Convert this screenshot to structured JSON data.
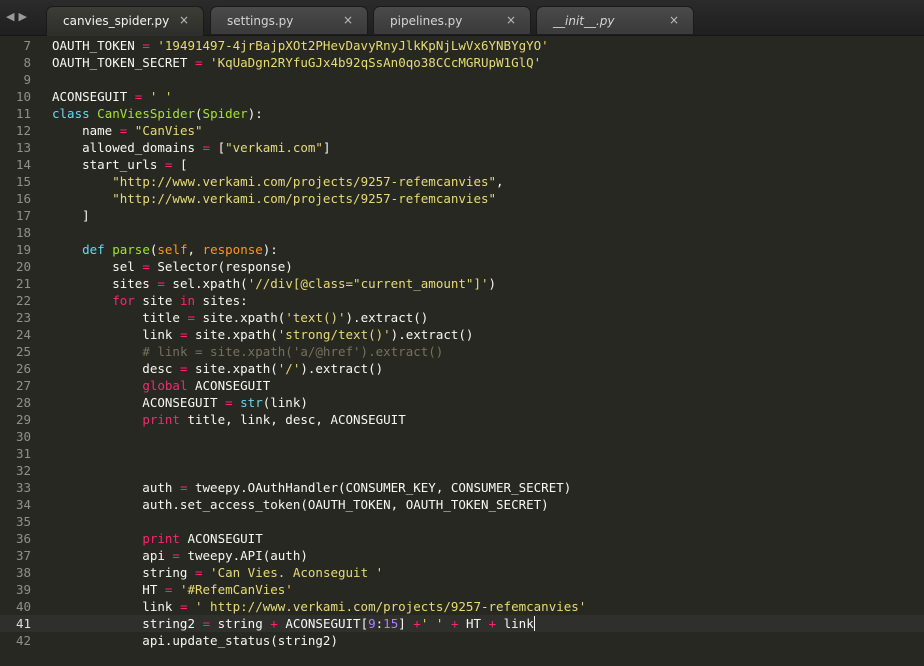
{
  "nav": {
    "back": "◀",
    "forward": "▶"
  },
  "tabs": [
    {
      "label": "canvies_spider.py",
      "close": "×",
      "active": true
    },
    {
      "label": "settings.py",
      "close": "×",
      "active": false
    },
    {
      "label": "pipelines.py",
      "close": "×",
      "active": false
    },
    {
      "label": "__init__.py",
      "close": "×",
      "active": false
    }
  ],
  "colors": {
    "background": "#272822",
    "keyword": "#f92672",
    "string": "#e6db74",
    "function": "#a6e22e",
    "builtin": "#66d9ef",
    "parameter": "#fd971f",
    "comment": "#75715e",
    "number": "#ae81ff"
  },
  "editor": {
    "current_line": 41,
    "lines": [
      {
        "n": "7",
        "t": [
          [
            "",
            "OAUTH_TOKEN "
          ],
          [
            "kw",
            "="
          ],
          [
            "st",
            " '19491497-4jrBajpXOt2PHevDavyRnyJlkKpNjLwVx6YNBYgYO'"
          ]
        ]
      },
      {
        "n": "8",
        "t": [
          [
            "",
            "OAUTH_TOKEN_SECRET "
          ],
          [
            "kw",
            "="
          ],
          [
            "st",
            " 'KqUaDgn2RYfuGJx4b92qSsAn0qo38CCcMGRUpW1GlQ'"
          ]
        ]
      },
      {
        "n": "9",
        "t": []
      },
      {
        "n": "10",
        "t": [
          [
            "",
            "ACONSEGUIT "
          ],
          [
            "kw",
            "="
          ],
          [
            "st",
            " ' '"
          ]
        ]
      },
      {
        "n": "11",
        "t": [
          [
            "bi",
            "class"
          ],
          [
            "",
            " "
          ],
          [
            "fn",
            "CanViesSpider"
          ],
          [
            "",
            "("
          ],
          [
            "fn",
            "Spider"
          ],
          [
            "",
            "):"
          ]
        ]
      },
      {
        "n": "12",
        "t": [
          [
            "",
            "    name "
          ],
          [
            "kw",
            "="
          ],
          [
            "st",
            " \"CanVies\""
          ]
        ]
      },
      {
        "n": "13",
        "t": [
          [
            "",
            "    allowed_domains "
          ],
          [
            "kw",
            "="
          ],
          [
            "",
            " ["
          ],
          [
            "st",
            "\"verkami.com\""
          ],
          [
            "",
            "]"
          ]
        ]
      },
      {
        "n": "14",
        "t": [
          [
            "",
            "    start_urls "
          ],
          [
            "kw",
            "="
          ],
          [
            "",
            " ["
          ]
        ]
      },
      {
        "n": "15",
        "t": [
          [
            "",
            "        "
          ],
          [
            "st",
            "\"http://www.verkami.com/projects/9257-refemcanvies\""
          ],
          [
            "",
            ","
          ]
        ]
      },
      {
        "n": "16",
        "t": [
          [
            "",
            "        "
          ],
          [
            "st",
            "\"http://www.verkami.com/projects/9257-refemcanvies\""
          ]
        ]
      },
      {
        "n": "17",
        "t": [
          [
            "",
            "    ]"
          ]
        ]
      },
      {
        "n": "18",
        "t": []
      },
      {
        "n": "19",
        "t": [
          [
            "",
            "    "
          ],
          [
            "bi",
            "def"
          ],
          [
            "",
            " "
          ],
          [
            "fn",
            "parse"
          ],
          [
            "",
            "("
          ],
          [
            "pa",
            "self"
          ],
          [
            "",
            ", "
          ],
          [
            "pa",
            "response"
          ],
          [
            "",
            "):"
          ]
        ]
      },
      {
        "n": "20",
        "t": [
          [
            "",
            "        sel "
          ],
          [
            "kw",
            "="
          ],
          [
            "",
            " Selector(response)"
          ]
        ]
      },
      {
        "n": "21",
        "t": [
          [
            "",
            "        sites "
          ],
          [
            "kw",
            "="
          ],
          [
            "",
            " sel.xpath("
          ],
          [
            "st",
            "'//div[@class=\"current_amount\"]'"
          ],
          [
            "",
            ")"
          ]
        ]
      },
      {
        "n": "22",
        "t": [
          [
            "",
            "        "
          ],
          [
            "kw",
            "for"
          ],
          [
            "",
            " site "
          ],
          [
            "kw",
            "in"
          ],
          [
            "",
            " sites:"
          ]
        ]
      },
      {
        "n": "23",
        "t": [
          [
            "",
            "            title "
          ],
          [
            "kw",
            "="
          ],
          [
            "",
            " site.xpath("
          ],
          [
            "st",
            "'text()'"
          ],
          [
            "",
            ").extract()"
          ]
        ]
      },
      {
        "n": "24",
        "t": [
          [
            "",
            "            link "
          ],
          [
            "kw",
            "="
          ],
          [
            "",
            " site.xpath("
          ],
          [
            "st",
            "'strong/text()'"
          ],
          [
            "",
            ").extract()"
          ]
        ]
      },
      {
        "n": "25",
        "t": [
          [
            "",
            "            "
          ],
          [
            "cm",
            "# link = site.xpath('a/@href').extract()"
          ]
        ]
      },
      {
        "n": "26",
        "t": [
          [
            "",
            "            desc "
          ],
          [
            "kw",
            "="
          ],
          [
            "",
            " site.xpath("
          ],
          [
            "st",
            "'/'"
          ],
          [
            "",
            ").extract()"
          ]
        ]
      },
      {
        "n": "27",
        "t": [
          [
            "",
            "            "
          ],
          [
            "kw",
            "global"
          ],
          [
            "",
            " ACONSEGUIT"
          ]
        ]
      },
      {
        "n": "28",
        "t": [
          [
            "",
            "            ACONSEGUIT "
          ],
          [
            "kw",
            "="
          ],
          [
            "",
            " "
          ],
          [
            "bi",
            "str"
          ],
          [
            "",
            "(link)"
          ]
        ]
      },
      {
        "n": "29",
        "t": [
          [
            "",
            "            "
          ],
          [
            "kw",
            "print"
          ],
          [
            "",
            " title, link, desc, ACONSEGUIT"
          ]
        ]
      },
      {
        "n": "30",
        "t": []
      },
      {
        "n": "31",
        "t": []
      },
      {
        "n": "32",
        "t": []
      },
      {
        "n": "33",
        "t": [
          [
            "",
            "            auth "
          ],
          [
            "kw",
            "="
          ],
          [
            "",
            " tweepy.OAuthHandler(CONSUMER_KEY, CONSUMER_SECRET)"
          ]
        ]
      },
      {
        "n": "34",
        "t": [
          [
            "",
            "            auth.set_access_token(OAUTH_TOKEN, OAUTH_TOKEN_SECRET)"
          ]
        ]
      },
      {
        "n": "35",
        "t": []
      },
      {
        "n": "36",
        "t": [
          [
            "",
            "            "
          ],
          [
            "kw",
            "print"
          ],
          [
            "",
            " ACONSEGUIT"
          ]
        ]
      },
      {
        "n": "37",
        "t": [
          [
            "",
            "            api "
          ],
          [
            "kw",
            "="
          ],
          [
            "",
            " tweepy.API(auth)"
          ]
        ]
      },
      {
        "n": "38",
        "t": [
          [
            "",
            "            string "
          ],
          [
            "kw",
            "="
          ],
          [
            "st",
            " 'Can Vies. Aconseguit '"
          ]
        ]
      },
      {
        "n": "39",
        "t": [
          [
            "",
            "            HT "
          ],
          [
            "kw",
            "="
          ],
          [
            "st",
            " '#RefemCanVies'"
          ]
        ]
      },
      {
        "n": "40",
        "t": [
          [
            "",
            "            link "
          ],
          [
            "kw",
            "="
          ],
          [
            "st",
            " ' http://www.verkami.com/projects/9257-refemcanvies'"
          ]
        ]
      },
      {
        "n": "41",
        "t": [
          [
            "",
            "            string2 "
          ],
          [
            "kw",
            "="
          ],
          [
            "",
            " string "
          ],
          [
            "kw",
            "+"
          ],
          [
            "",
            " ACONSEGUIT["
          ],
          [
            "nm",
            "9"
          ],
          [
            "",
            ":"
          ],
          [
            "nm",
            "15"
          ],
          [
            "",
            "] "
          ],
          [
            "kw",
            "+"
          ],
          [
            "st",
            "' '"
          ],
          [
            "",
            " "
          ],
          [
            "kw",
            "+"
          ],
          [
            "",
            " HT "
          ],
          [
            "kw",
            "+"
          ],
          [
            "",
            " link"
          ]
        ],
        "cursor": true
      },
      {
        "n": "42",
        "t": [
          [
            "",
            "            api.update_status(string2)"
          ]
        ]
      }
    ]
  }
}
